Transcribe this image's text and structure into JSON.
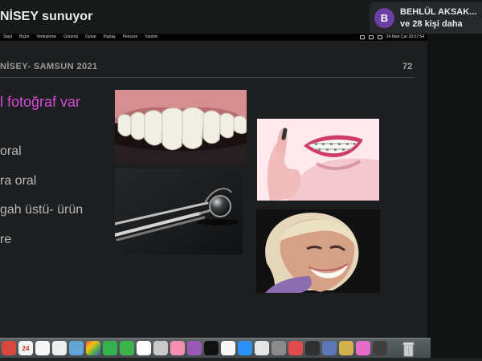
{
  "header": {
    "presenter_title": "NİSEY sunuyor",
    "participant_initial": "B",
    "participant_name": "BEHLÜL AKSAK...",
    "participant_more": "ve 28 kişi daha"
  },
  "menu": {
    "items": [
      "Slayt",
      "Biçim",
      "Yerleştirme",
      "Görüntü",
      "Oynat",
      "Paylaş",
      "Pencere",
      "Yardım"
    ],
    "clock": "24 Mart Çar  20:57:54"
  },
  "slide": {
    "header": "NİSEY- SAMSUN 2021",
    "number": "72",
    "heading": "l fotoğraf var",
    "bullets": [
      "oral",
      "ra  oral",
      "gah üstü- ürün",
      "re"
    ]
  },
  "dock": {
    "calendar_day": "24"
  },
  "colors": {
    "app_bar": "#161a19",
    "slide_background": "#1c1e1f",
    "heading_accent": "#d24bd6",
    "avatar": "#6b3fa3"
  },
  "icons": [
    "avatar",
    "apple-menu-status-icons",
    "teeth-photo",
    "dental-mirror-photo",
    "braces-smile-photo",
    "smiling-woman-photo",
    "trash-icon"
  ]
}
